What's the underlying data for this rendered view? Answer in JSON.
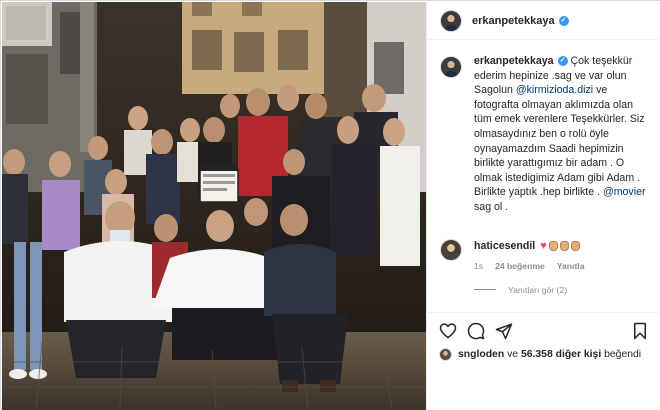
{
  "post": {
    "username": "erkanpetekkaya",
    "verified_icon": "verified-badge-icon"
  },
  "caption": {
    "username": "erkanpetekkaya",
    "part1": "Çok teşekkür ederim hepinize .sag ve var olun Sagolun",
    "mention1": "@kirmizioda.dizi",
    "part2": "ve fotografta olmayan aklımızda olan tüm emek verenlere Teşekkürler. Siz olmasaydınız ben o rolü öyle oynayamazdım Saadi hepimizin birlikte yarattıgımız bir adam . O olmak istedigimiz Adam gibi Adam . Birlikte yaptık .hep birlikte .",
    "mention2": "@movier",
    "part3": "sag ol ."
  },
  "comment": {
    "username": "haticesendil",
    "emojis": [
      "red-heart",
      "clapping-hands",
      "clapping-hands",
      "clapping-hands"
    ],
    "time": "1s",
    "likes": "24 beğenme",
    "reply": "Yanıtla",
    "view_replies": "Yanıtları gör (2)"
  },
  "likes_summary": {
    "user": "sngloden",
    "connector": " ve ",
    "count": "56.358 diğer kişi",
    "suffix": " beğendi"
  },
  "colors": {
    "link": "#00376b",
    "verified": "#3897f0",
    "heart": "#ed4956",
    "muted": "#8e8e8e"
  },
  "icons": [
    "heart-icon",
    "comment-icon",
    "share-icon",
    "bookmark-icon"
  ]
}
